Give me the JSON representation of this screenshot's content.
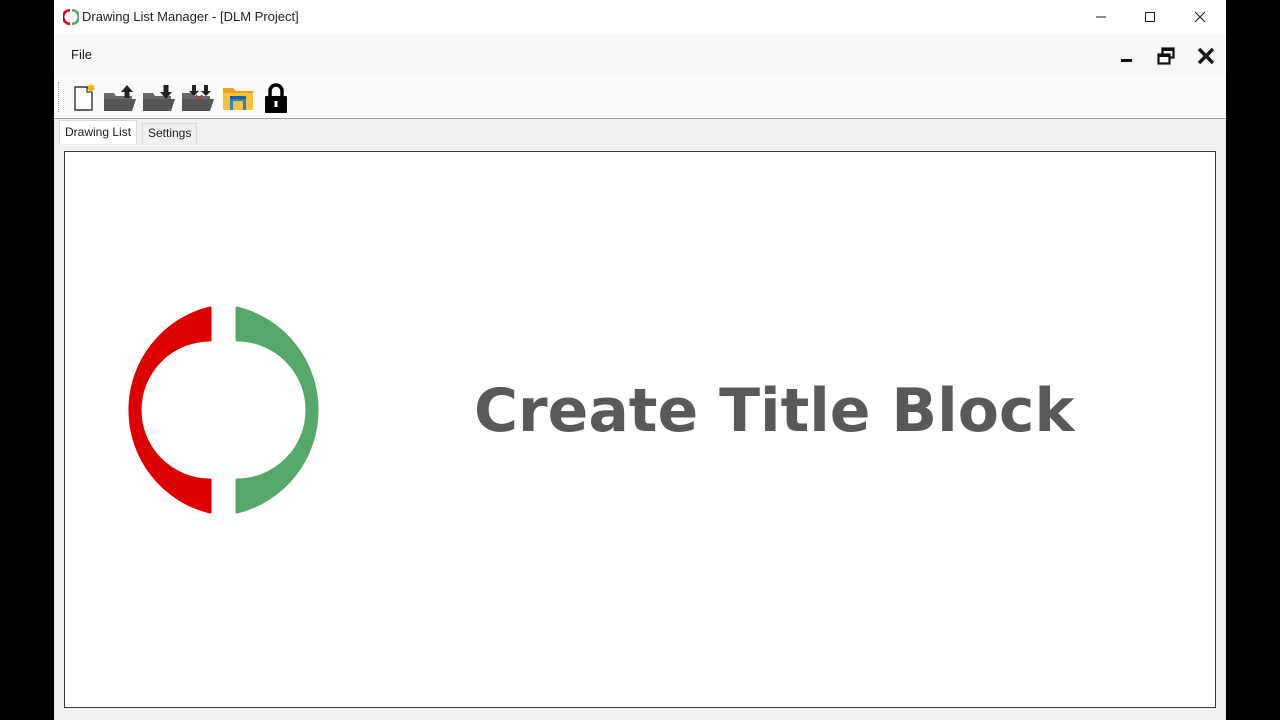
{
  "window": {
    "title": "Drawing List Manager - [DLM Project]"
  },
  "title_controls": [
    {
      "name": "minimize",
      "icon": "minimize-icon"
    },
    {
      "name": "maximize",
      "icon": "maximize-icon"
    },
    {
      "name": "close",
      "icon": "close-icon"
    }
  ],
  "menu": {
    "file_label": "File"
  },
  "mdi_controls": [
    {
      "name": "child-minimize",
      "icon": "minimize-icon"
    },
    {
      "name": "child-restore",
      "icon": "restore-icon"
    },
    {
      "name": "child-close",
      "icon": "close-icon"
    }
  ],
  "toolbar": {
    "buttons": [
      {
        "name": "new",
        "icon": "new-document-icon"
      },
      {
        "name": "open-upload",
        "icon": "folder-upload-icon"
      },
      {
        "name": "open-download",
        "icon": "folder-download-icon"
      },
      {
        "name": "open-merge",
        "icon": "folder-merge-icon"
      },
      {
        "name": "explorer",
        "icon": "file-explorer-icon"
      },
      {
        "name": "lock",
        "icon": "lock-icon"
      }
    ]
  },
  "tabs": [
    {
      "label": "Drawing List",
      "active": true
    },
    {
      "label": "Settings",
      "active": false
    }
  ],
  "main": {
    "heading": "Create Title Block"
  },
  "colors": {
    "logo_red": "#dd0000",
    "logo_green": "#55a868",
    "heading_gray": "#595959"
  }
}
